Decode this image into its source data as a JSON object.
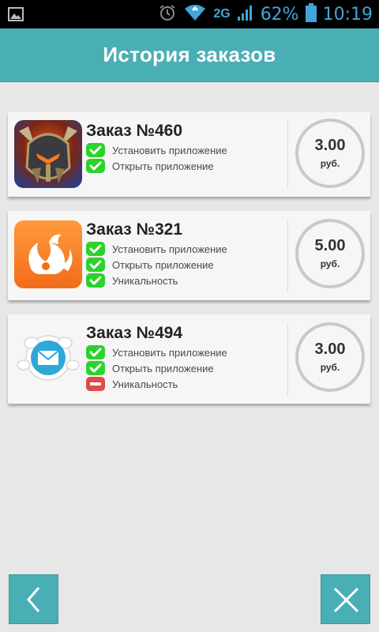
{
  "status_bar": {
    "network": "2G",
    "battery": "62%",
    "time": "10:19"
  },
  "header": {
    "title": "История заказов"
  },
  "orders": [
    {
      "title": "Заказ №460",
      "icon": "dark-knight-game-icon",
      "requirements": [
        {
          "label": "Установить приложение",
          "status": "done"
        },
        {
          "label": "Открыть приложение",
          "status": "done"
        }
      ],
      "price": "3.00",
      "unit": "руб."
    },
    {
      "title": "Заказ №321",
      "icon": "uc-browser-squirrel-icon",
      "requirements": [
        {
          "label": "Установить приложение",
          "status": "done"
        },
        {
          "label": "Открыть приложение",
          "status": "done"
        },
        {
          "label": "Уникальность",
          "status": "done"
        }
      ],
      "price": "5.00",
      "unit": "руб."
    },
    {
      "title": "Заказ №494",
      "icon": "mail-envelope-icon",
      "requirements": [
        {
          "label": "Установить приложение",
          "status": "done"
        },
        {
          "label": "Открыть приложение",
          "status": "done"
        },
        {
          "label": "Уникальность",
          "status": "failed"
        }
      ],
      "price": "3.00",
      "unit": "руб."
    }
  ],
  "colors": {
    "accent": "#4aaeb5",
    "done": "#2ad32a",
    "failed": "#e04a4a",
    "background": "#e7e7e7"
  }
}
